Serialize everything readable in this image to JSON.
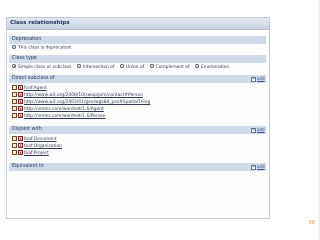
{
  "panel": {
    "title": "Class relationships"
  },
  "deprecation": {
    "header": "Deprecation",
    "checkbox_label": "This class is deprecated."
  },
  "class_type": {
    "header": "Class type",
    "options": [
      "Simple class or subclass",
      "Intersection of",
      "Union of",
      "Complement of",
      "Enumeration"
    ],
    "selected": "Simple class or subclass"
  },
  "direct_subclass": {
    "header": "Direct subclass of",
    "add_label": "add",
    "items": [
      "foaf:Agent",
      "http://www.w3.org/2000/10/swap/pim/contact#Person",
      "http://www.w3.org/2003/01/geo/wgs84_pos#SpatialThing",
      "http://xmlns.com/wordnet/1.6/Agent",
      "http://xmlns.com/wordnet/1.6/Person"
    ]
  },
  "disjoint": {
    "header": "Disjoint with",
    "add_label": "add",
    "items": [
      "foaf:Document",
      "foaf:Organization",
      "foaf:Project"
    ]
  },
  "equivalent": {
    "header": "Equivalent to",
    "add_label": "add"
  },
  "footer": {
    "page_number": "58"
  }
}
